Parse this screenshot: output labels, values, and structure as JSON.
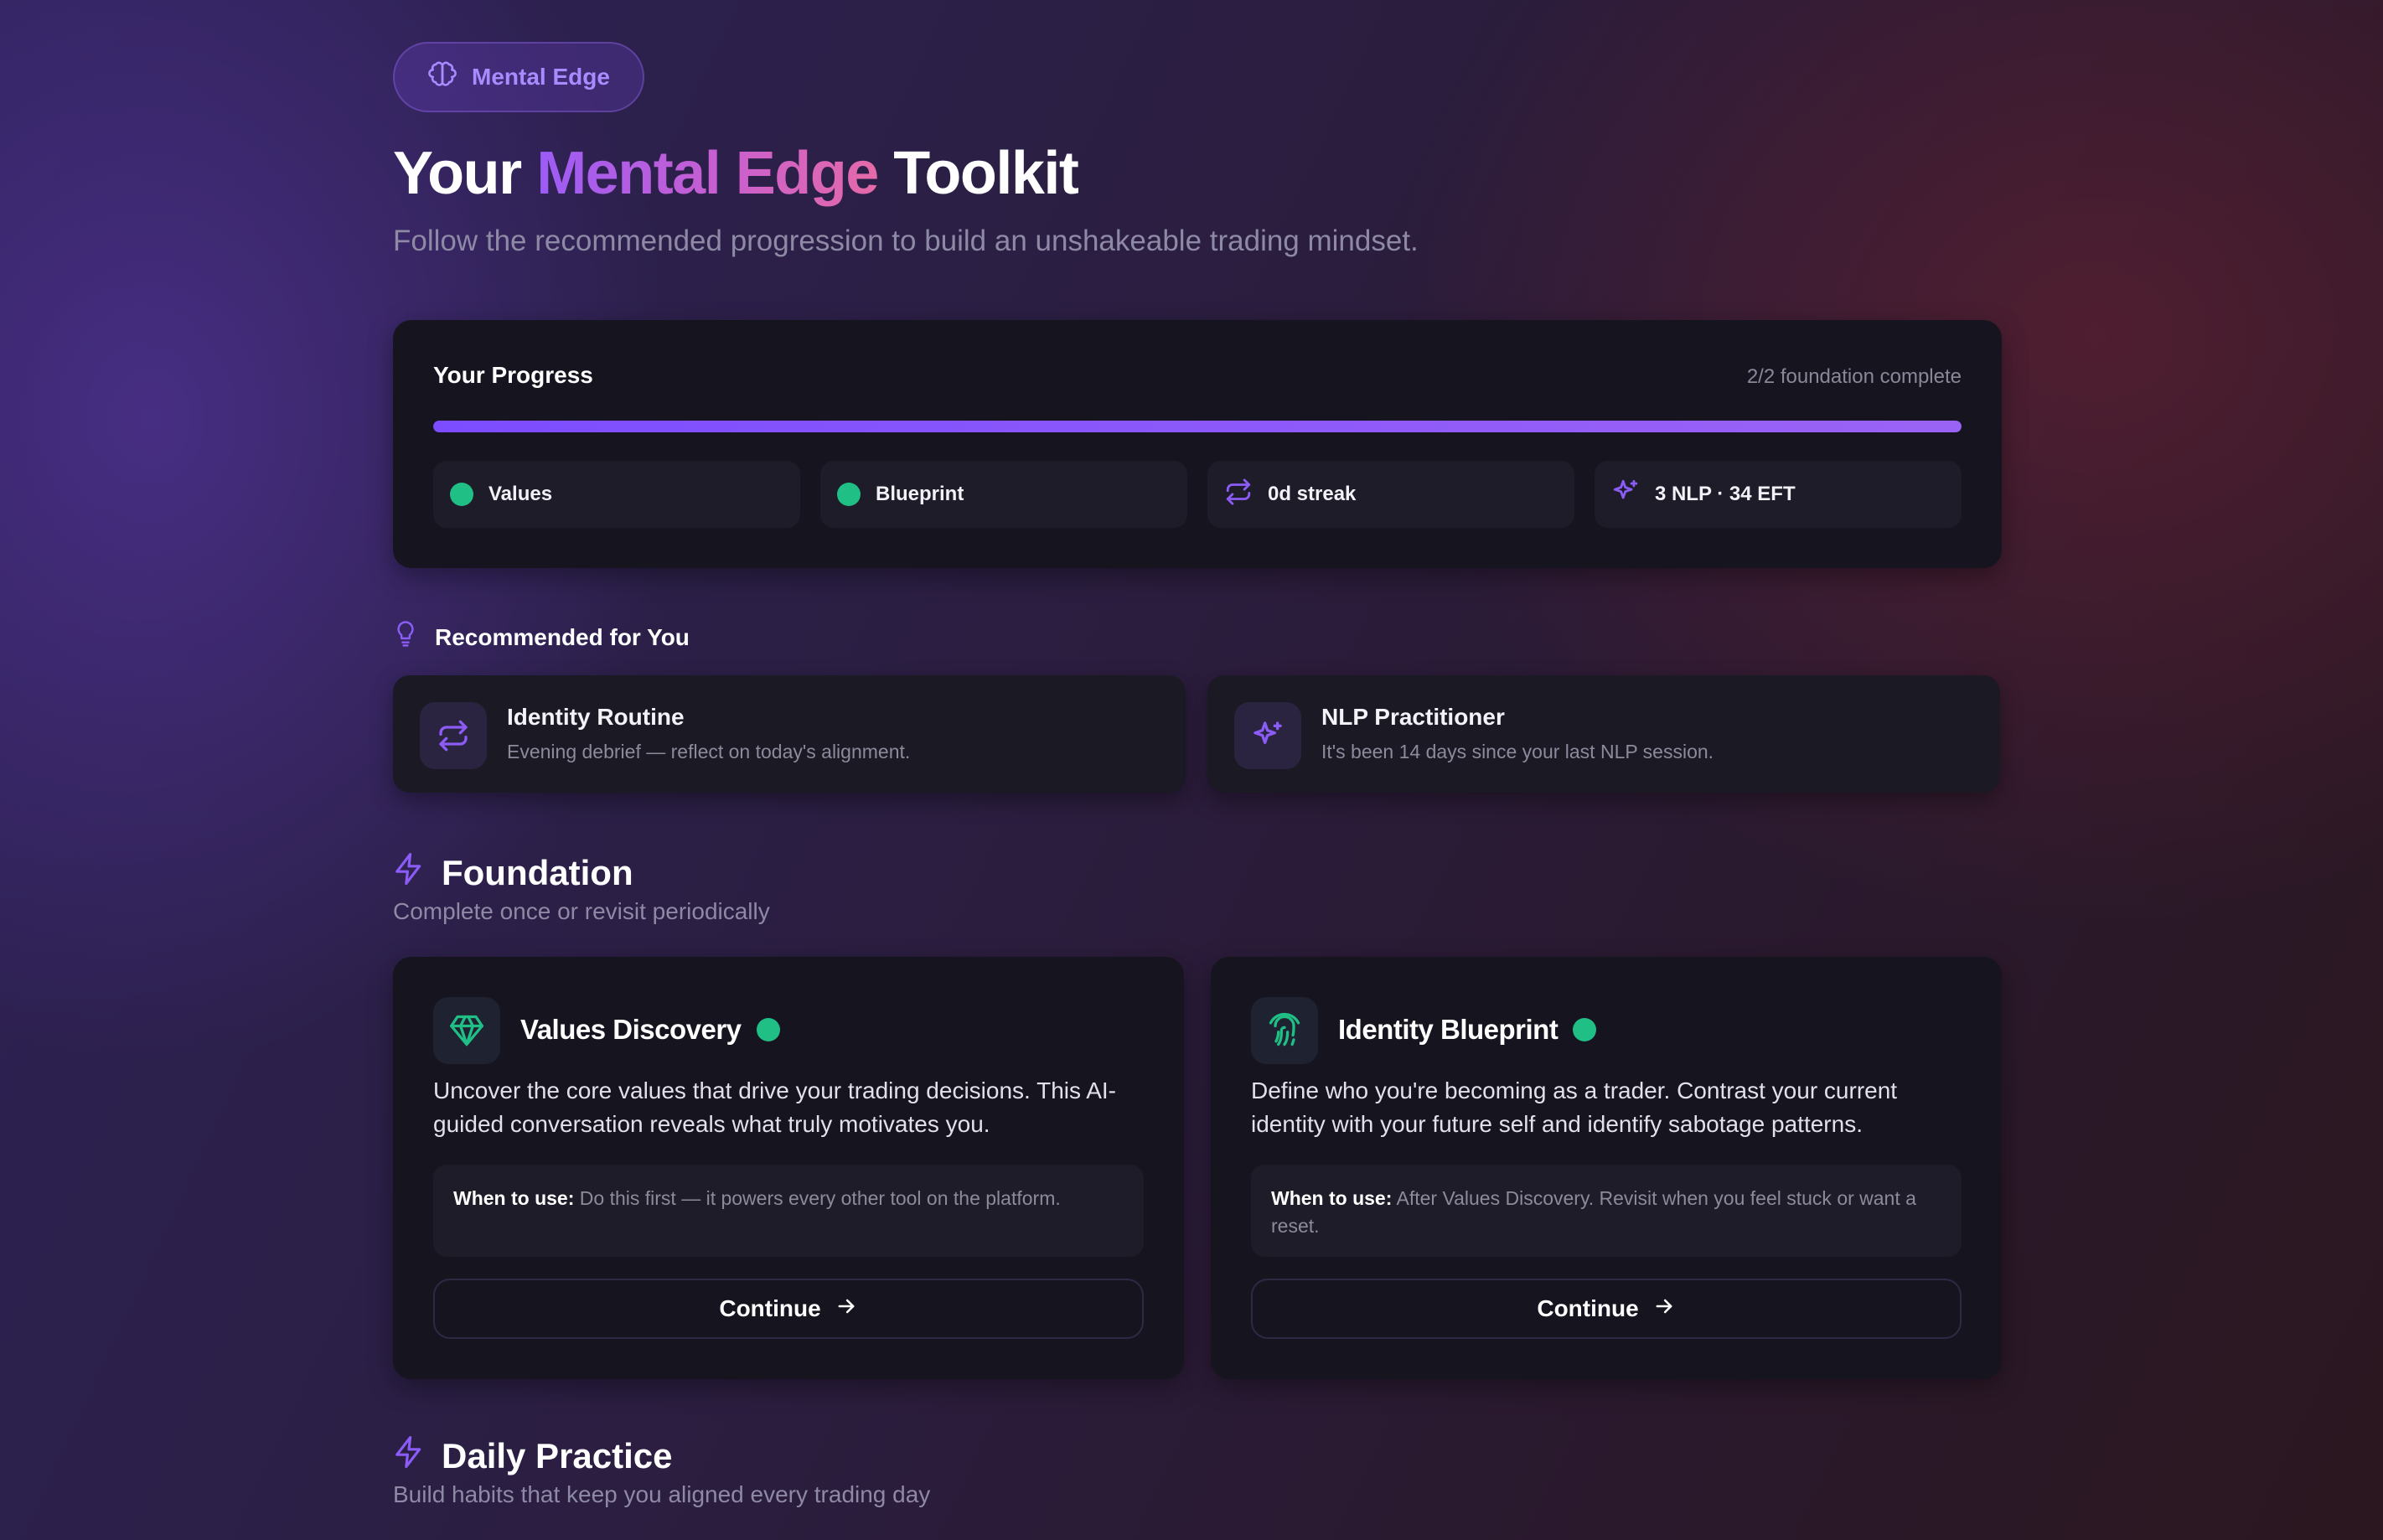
{
  "badge": {
    "label": "Mental Edge",
    "icon": "brain-icon"
  },
  "hero": {
    "title_prefix": "Your",
    "title_highlight": "Mental Edge",
    "title_suffix": "Toolkit",
    "subtitle": "Follow the recommended progression to build an unshakeable trading mindset."
  },
  "progress": {
    "title": "Your Progress",
    "status": "2/2 foundation complete",
    "fraction": 1.0,
    "chips": [
      {
        "label": "Values",
        "icon": "green-dot"
      },
      {
        "label": "Blueprint",
        "icon": "green-dot"
      },
      {
        "label": "0d streak",
        "icon": "repeat-icon"
      },
      {
        "label": "3 NLP · 34 EFT",
        "icon": "sparkles-icon"
      }
    ]
  },
  "recommended": {
    "heading": "Recommended for You",
    "items": [
      {
        "title": "Identity Routine",
        "description": "Evening debrief — reflect on today's alignment.",
        "icon": "repeat-icon"
      },
      {
        "title": "NLP Practitioner",
        "description": "It's been 14 days since your last NLP session.",
        "icon": "sparkles-icon"
      }
    ]
  },
  "foundation": {
    "heading": "Foundation",
    "subtitle": "Complete once or revisit periodically",
    "cards": [
      {
        "title": "Values Discovery",
        "icon": "gem-icon",
        "description": "Uncover the core values that drive your trading decisions. This AI-guided conversation reveals what truly motivates you.",
        "when_label": "When to use:",
        "when_text": "Do this first — it powers every other tool on the platform.",
        "button": "Continue"
      },
      {
        "title": "Identity Blueprint",
        "icon": "fingerprint-icon",
        "description": "Define who you're becoming as a trader. Contrast your current identity with your future self and identify sabotage patterns.",
        "when_label": "When to use:",
        "when_text": "After Values Discovery. Revisit when you feel stuck or want a reset.",
        "button": "Continue"
      }
    ]
  },
  "daily": {
    "heading": "Daily Practice",
    "subtitle": "Build habits that keep you aligned every trading day"
  },
  "colors": {
    "accent": "#7c4dff",
    "success": "#1fbf86",
    "card": "#16151f"
  }
}
